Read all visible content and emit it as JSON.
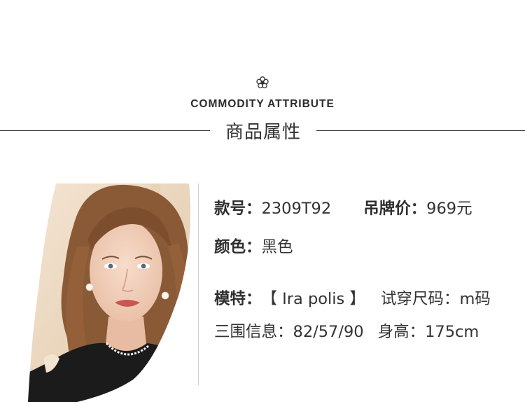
{
  "header": {
    "en_title": "COMMODITY ATTRIBUTE",
    "cn_title": "商品属性",
    "ornament_icon": "flower-icon"
  },
  "photo": {
    "icon": "model-photo"
  },
  "attributes": {
    "style_no_label": "款号：",
    "style_no_value": "2309T92",
    "price_label": "吊牌价：",
    "price_value": "969元",
    "color_label": "颜色：",
    "color_value": "黑色",
    "model_label": "模特：",
    "model_value": "【 Ira polis 】",
    "size_label": "试穿尺码：",
    "size_value": "m码",
    "measure_label": "三围信息：",
    "measure_value": "82/57/90",
    "height_label": "身高：",
    "height_value": "175cm"
  },
  "colors": {
    "text": "#333333",
    "rule": "#3a3a3a",
    "divider": "#cfcfcf",
    "shirt": "#1b1b1b",
    "hair": "#8a5a36"
  }
}
